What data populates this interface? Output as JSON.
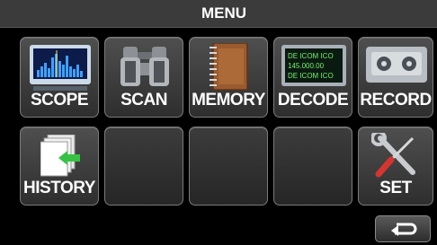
{
  "header": {
    "title": "MENU"
  },
  "tiles": [
    {
      "label": "SCOPE"
    },
    {
      "label": "SCAN"
    },
    {
      "label": "MEMORY"
    },
    {
      "label": "DECODE",
      "icon_text": [
        "DE ICOM ICO",
        "145.000.00",
        "DE ICOM ICO"
      ]
    },
    {
      "label": "RECORD"
    },
    {
      "label": "HISTORY"
    },
    {
      "label": "SET"
    }
  ],
  "icons": {
    "scope": "spectrum-scope-icon",
    "scan": "binoculars-icon",
    "memory": "notebook-icon",
    "decode": "decode-display-icon",
    "record": "cassette-icon",
    "history": "history-arrow-icon",
    "set": "wrench-screwdriver-icon",
    "back": "return-arrow-icon"
  },
  "colors": {
    "title_bar": "#3b3b3b",
    "tile_border": "#7a7a7a",
    "decode_text": "#6cf36c"
  }
}
